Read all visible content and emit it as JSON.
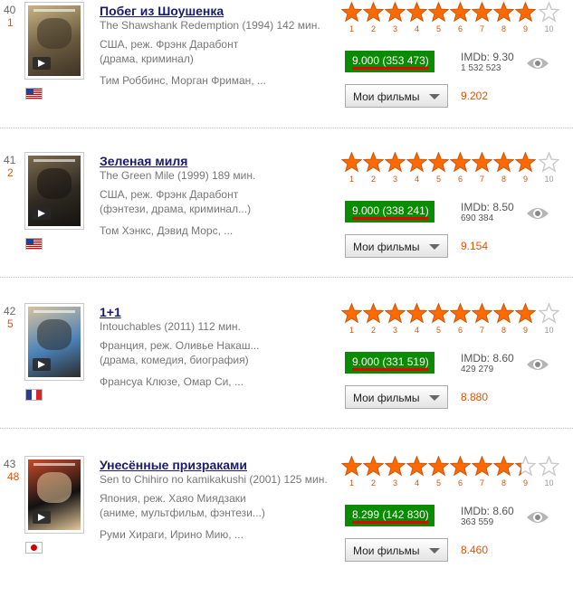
{
  "films": [
    {
      "position": "40",
      "movement": "1",
      "title": "Побег из Шоушенка",
      "original": "The Shawshank Redemption (1994) 142 мин.",
      "country_director": "США, реж. Фрэнк Дарабонт",
      "genres": "(драма, криминал)",
      "actors": "Тим Роббинс, Морган Фриман, ...",
      "flag": "us",
      "poster_colors": [
        "#6b5a3e",
        "#c8b483",
        "#3d3326"
      ],
      "stars_filled": 9,
      "score": "9.000",
      "votes": "(353 473)",
      "imdb": "IMDb: 9.30",
      "imdb_votes": "1 532 523",
      "list_label": "Мои фильмы",
      "my_rating": "9.202"
    },
    {
      "position": "41",
      "movement": "2",
      "title": "Зеленая миля",
      "original": "The Green Mile (1999) 189 мин.",
      "country_director": "США, реж. Фрэнк Дарабонт",
      "genres": "(фэнтези, драма, криминал...)",
      "actors": "Том Хэнкс, Дэвид Морс, ...",
      "flag": "us",
      "poster_colors": [
        "#2f2a22",
        "#7d6b4d",
        "#151311"
      ],
      "stars_filled": 9,
      "score": "9.000",
      "votes": "(338 241)",
      "imdb": "IMDb: 8.50",
      "imdb_votes": "690 384",
      "list_label": "Мои фильмы",
      "my_rating": "9.154"
    },
    {
      "position": "42",
      "movement": "5",
      "title": "1+1",
      "original": "Intouchables (2011) 112 мин.",
      "country_director": "Франция, реж. Оливье Накаш...",
      "genres": "(драма, комедия, биография)",
      "actors": "Франсуа Клюзе, Омар Си, ...",
      "flag": "fr",
      "poster_colors": [
        "#4a82b8",
        "#d8c2a0",
        "#2c2c2c"
      ],
      "stars_filled": 9,
      "score": "9.000",
      "votes": "(331 519)",
      "imdb": "IMDb: 8.60",
      "imdb_votes": "429 279",
      "list_label": "Мои фильмы",
      "my_rating": "8.880"
    },
    {
      "position": "43",
      "movement": "48",
      "title": "Унесённые призраками",
      "original": "Sen to Chihiro no kamikakushi (2001) 125 мин.",
      "country_director": "Япония, реж. Хаяо Миядзаки",
      "genres": "(аниме, мультфильм, фэнтези...)",
      "actors": "Руми Хираги, Ирино Мию, ...",
      "flag": "jp",
      "poster_colors": [
        "#111111",
        "#c94a2a",
        "#e6c79a"
      ],
      "stars_filled": 8.3,
      "score": "8.299",
      "votes": "(142 830)",
      "imdb": "IMDb: 8.60",
      "imdb_votes": "363 559",
      "list_label": "Мои фильмы",
      "my_rating": "8.460"
    }
  ],
  "star_labels": [
    "1",
    "2",
    "3",
    "4",
    "5",
    "6",
    "7",
    "8",
    "9",
    "10"
  ],
  "colors": {
    "star": "#ff6a00",
    "score_bg": "#0a8c00",
    "rank_move": "#e65100",
    "title": "#1a1a6e"
  }
}
